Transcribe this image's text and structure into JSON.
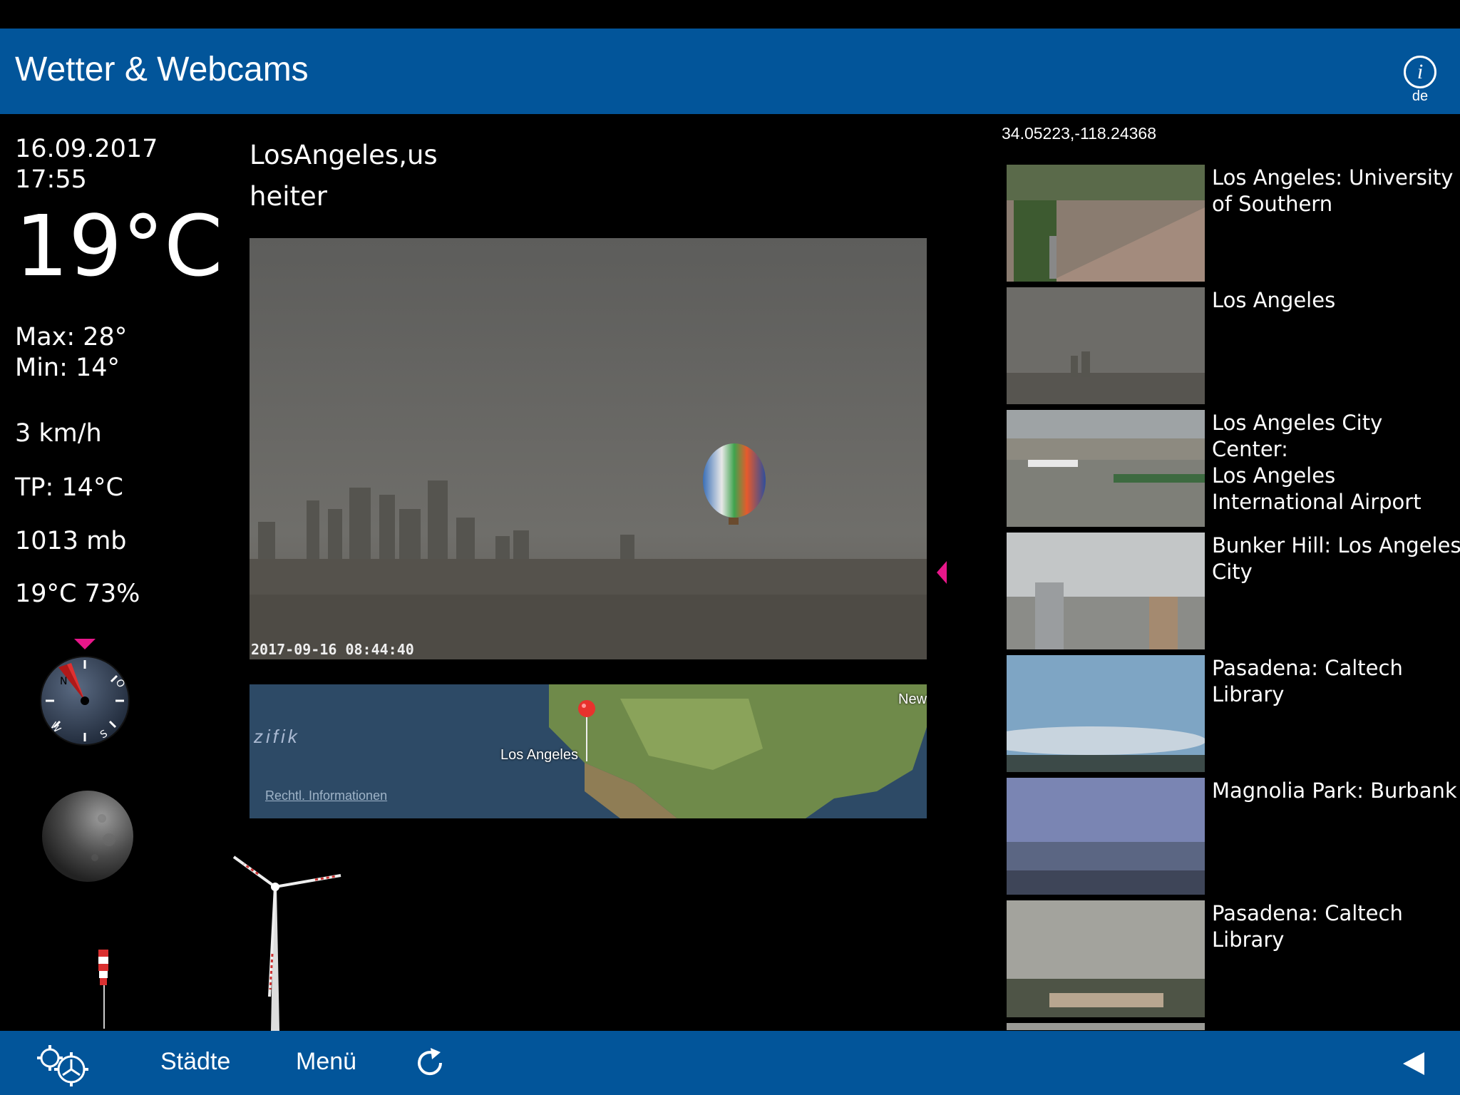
{
  "header": {
    "title": "Wetter & Webcams",
    "info_lang": "de"
  },
  "weather": {
    "date": "16.09.2017",
    "time": "17:55",
    "temperature": "19°C",
    "max": "Max: 28°",
    "min": "Min: 14°",
    "wind": "3 km/h",
    "dewpoint": "TP: 14°C",
    "pressure": "1013 mb",
    "humidity": "19°C 73%",
    "city": "LosAngeles,us",
    "condition": "heiter"
  },
  "webcam_main": {
    "timestamp": "2017-09-16 08:44:40"
  },
  "map": {
    "ocean_label": "zifik",
    "city_label": "Los Angeles",
    "ny_label": "New",
    "legal": "Rechtl. Informationen"
  },
  "coords": "34.05223,-118.24368",
  "webcams": [
    {
      "title": "Los Angeles: University\nof Southern"
    },
    {
      "title": "Los Angeles"
    },
    {
      "title": "Los Angeles City Center:\nLos Angeles\nInternational Airport"
    },
    {
      "title": "Bunker Hill: Los Angeles\nCity"
    },
    {
      "title": "Pasadena: Caltech\nLibrary"
    },
    {
      "title": "Magnolia Park: Burbank"
    },
    {
      "title": "Pasadena: Caltech\nLibrary"
    }
  ],
  "toolbar": {
    "cities": "Städte",
    "menu": "Menü"
  },
  "colors": {
    "bar": "#02559a",
    "accent": "#e8178a"
  }
}
